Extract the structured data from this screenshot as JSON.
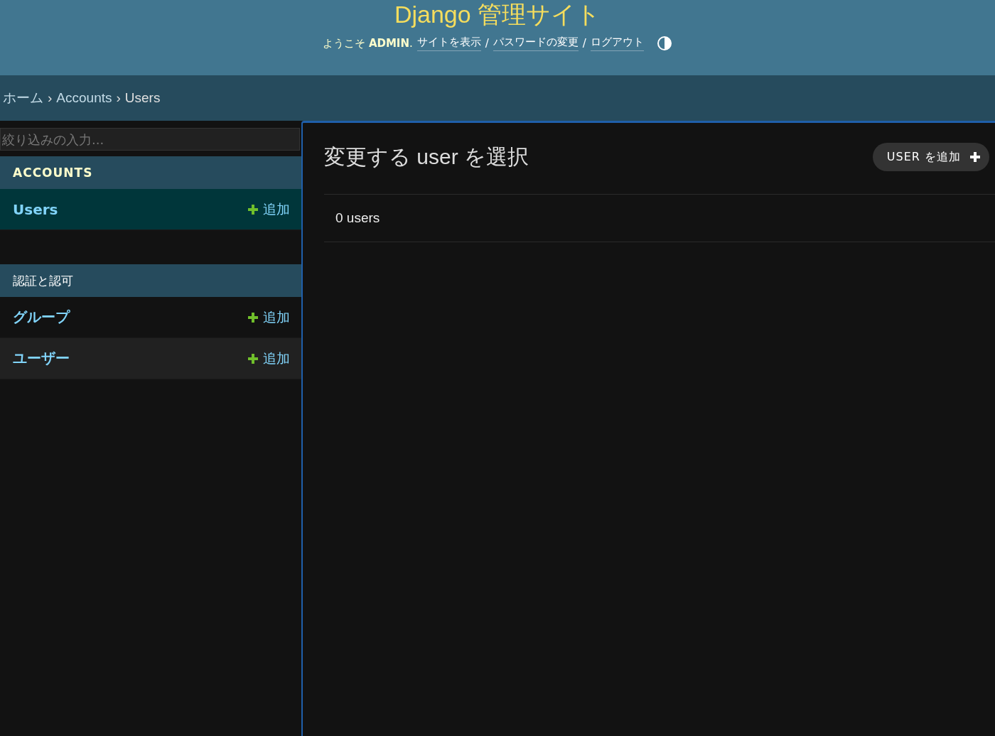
{
  "header": {
    "title": "Django 管理サイト",
    "welcome": "ようこそ **ADMIN**.",
    "links": [
      {
        "label": "サイトを表示"
      },
      {
        "label": "パスワードの変更"
      },
      {
        "label": "ログアウト"
      }
    ],
    "link_separator": "/"
  },
  "breadcrumbs": {
    "items": [
      "ホーム",
      "Accounts",
      "Users"
    ],
    "separator": "›"
  },
  "sidebar": {
    "filter": {
      "placeholder": "絞り込みの入力..."
    },
    "apps": [
      {
        "name": "ACCOUNTS",
        "selected": true,
        "models": [
          {
            "name": "Users",
            "add": "追加",
            "selected": true,
            "highlighted": false
          }
        ]
      },
      {
        "name": "認証と認可",
        "selected": false,
        "models": [
          {
            "name": "グループ",
            "add": "追加",
            "selected": false,
            "highlighted": false
          },
          {
            "name": "ユーザー",
            "add": "追加",
            "selected": false,
            "highlighted": true
          }
        ]
      }
    ]
  },
  "content": {
    "title": "変更する user を選択",
    "add_button": "USER を追加",
    "count": "0 users"
  }
}
